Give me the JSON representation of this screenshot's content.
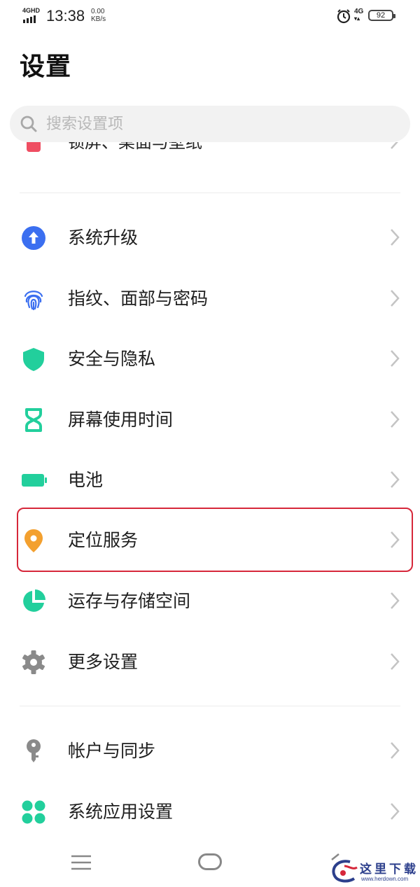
{
  "status_bar": {
    "network_label": "4GHD",
    "time": "13:38",
    "speed_value": "0.00",
    "speed_unit": "KB/s",
    "mobile_data": "4G",
    "battery": "92"
  },
  "page_title": "设置",
  "search": {
    "placeholder": "搜索设置项"
  },
  "clipped_item": {
    "label": "锁屏、桌面与壁纸",
    "icon": "wallpaper-icon",
    "color": "#ef4e62"
  },
  "items_group1": [
    {
      "label": "系统升级",
      "icon": "system-update-icon",
      "color": "#3b6ff0"
    },
    {
      "label": "指纹、面部与密码",
      "icon": "fingerprint-icon",
      "color": "#3b6ff0"
    },
    {
      "label": "安全与隐私",
      "icon": "shield-icon",
      "color": "#22cf9c"
    },
    {
      "label": "屏幕使用时间",
      "icon": "hourglass-icon",
      "color": "#22cf9c"
    },
    {
      "label": "电池",
      "icon": "battery-icon",
      "color": "#22cf9c"
    },
    {
      "label": "定位服务",
      "icon": "location-pin-icon",
      "color": "#f3a02f",
      "highlighted": true
    },
    {
      "label": "运存与存储空间",
      "icon": "storage-pie-icon",
      "color": "#22cf9c"
    },
    {
      "label": "更多设置",
      "icon": "gear-icon",
      "color": "#8a8a8a"
    }
  ],
  "items_group2": [
    {
      "label": "帐户与同步",
      "icon": "key-icon",
      "color": "#8a8a8a"
    },
    {
      "label": "系统应用设置",
      "icon": "apps-grid-icon",
      "color": "#22cf9c"
    }
  ],
  "highlight_color": "#d6273a",
  "watermark": {
    "text": "这里下载",
    "url": "www.herdown.com"
  }
}
